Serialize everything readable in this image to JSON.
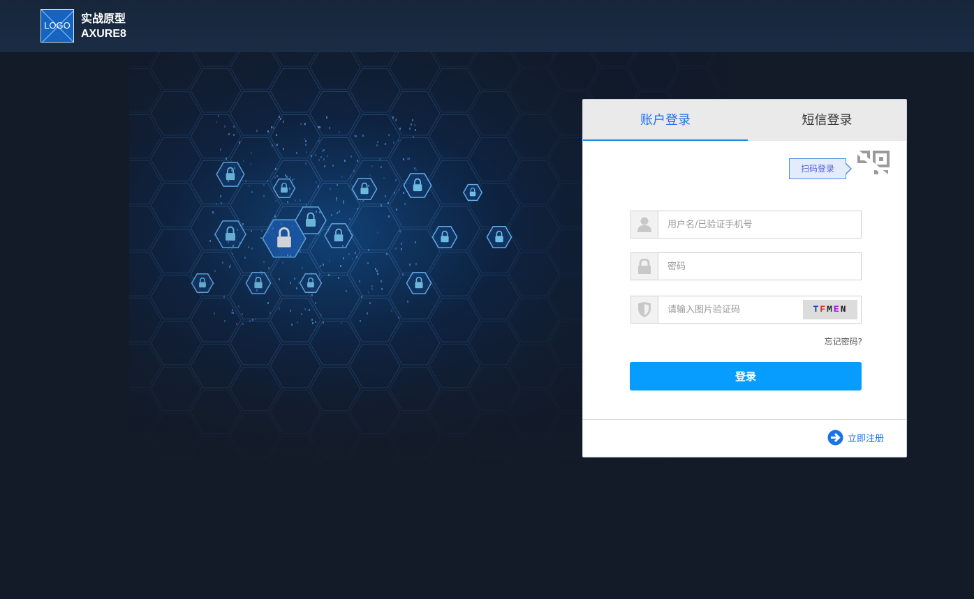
{
  "header": {
    "logo_text": "LOGO",
    "brand_line1": "实战原型",
    "brand_line2": "AXURE8"
  },
  "login": {
    "tabs": [
      {
        "label": "账户登录",
        "active": true
      },
      {
        "label": "短信登录",
        "active": false
      }
    ],
    "qr_label": "扫码登录",
    "username": {
      "value": "",
      "placeholder": "用户名/已验证手机号",
      "icon": "user-icon"
    },
    "password": {
      "value": "",
      "placeholder": "密码",
      "icon": "lock-icon"
    },
    "captcha": {
      "value": "",
      "placeholder": "请输入图片验证码",
      "icon": "shield-icon",
      "code_chars": [
        {
          "ch": "T",
          "color": "#2438c8"
        },
        {
          "ch": "F",
          "color": "#e0301e"
        },
        {
          "ch": "M",
          "color": "#222222"
        },
        {
          "ch": "E",
          "color": "#a020c8"
        },
        {
          "ch": "N",
          "color": "#222222"
        }
      ]
    },
    "forgot_label": "忘记密码?",
    "submit_label": "登录",
    "register_label": "立即注册",
    "accent_color": "#069dff"
  }
}
